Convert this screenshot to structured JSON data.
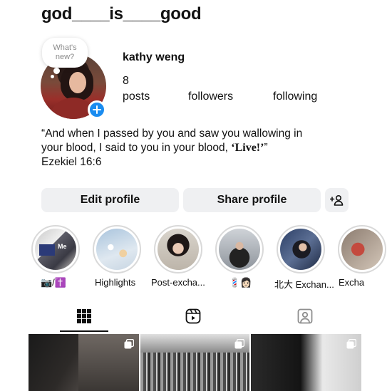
{
  "profile": {
    "username": "god____is____good",
    "display_name": "kathy weng",
    "note_text": "What's new?",
    "posts_count": "8",
    "posts_label": "posts",
    "followers_label": "followers",
    "following_label": "following",
    "bio_line1": "“And when I passed by you and saw you wallowing in",
    "bio_line2_pre": "your blood, I said to you in your blood, ",
    "bio_live": "‘Live!’",
    "bio_line2_post": "”",
    "bio_line3": "Ezekiel 16:6"
  },
  "actions": {
    "edit_label": "Edit profile",
    "share_label": "Share profile",
    "add_person_icon": "add-person-icon"
  },
  "highlights": [
    {
      "label": "📷/✝️"
    },
    {
      "label": "Highlights"
    },
    {
      "label": "Post-excha..."
    },
    {
      "label": "💈👩🏻"
    },
    {
      "label": "北大 Exchan..."
    },
    {
      "label": "Excha"
    }
  ],
  "tabs": [
    {
      "icon": "grid-icon",
      "selected": true
    },
    {
      "icon": "reels-icon",
      "selected": false
    },
    {
      "icon": "tagged-icon",
      "selected": false
    }
  ],
  "colors": {
    "accent_blue": "#1a8cf0",
    "button_bg": "#eff0f2",
    "text": "#111111"
  }
}
